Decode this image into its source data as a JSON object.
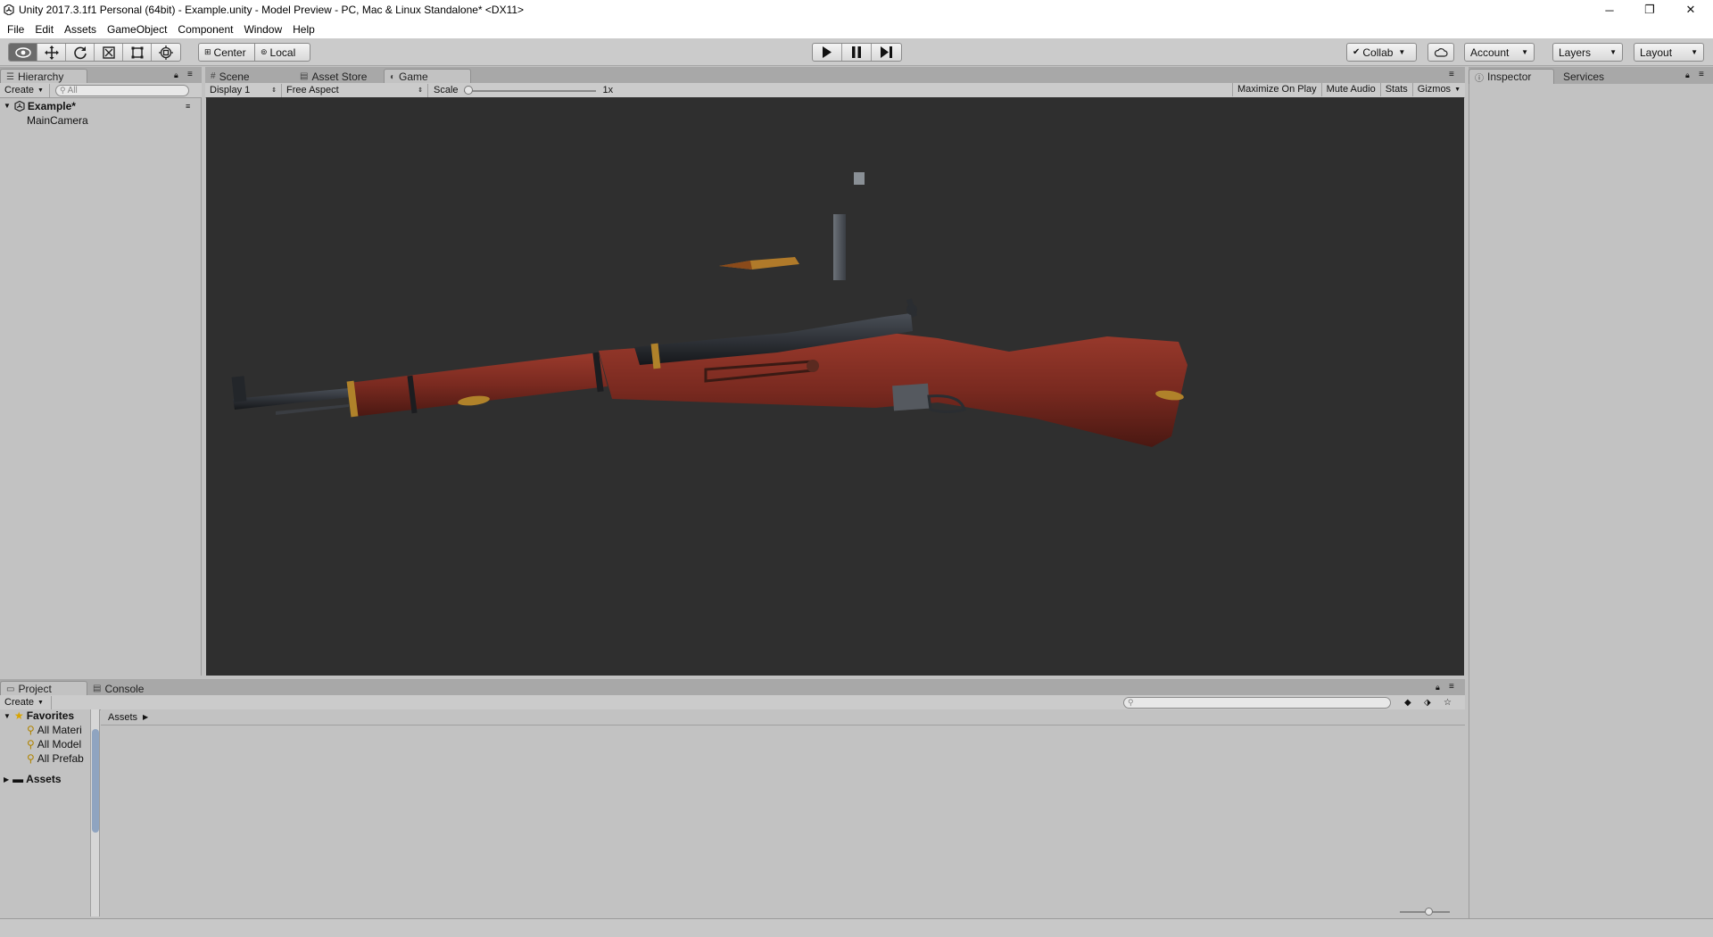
{
  "window": {
    "title": "Unity 2017.3.1f1 Personal (64bit) - Example.unity - Model Preview - PC, Mac & Linux Standalone* <DX11>",
    "minimize_glyph": "─",
    "restore_glyph": "❐",
    "close_glyph": "✕"
  },
  "menu": [
    "File",
    "Edit",
    "Assets",
    "GameObject",
    "Component",
    "Window",
    "Help"
  ],
  "toolbar": {
    "tools": [
      "view-tool",
      "move-tool",
      "rotate-tool",
      "scale-tool",
      "rect-tool",
      "transform-tool"
    ],
    "active_tool": "view-tool",
    "pivot_label": "Center",
    "space_label": "Local",
    "collab_label": "Collab",
    "account_label": "Account",
    "layers_label": "Layers",
    "layout_label": "Layout"
  },
  "hierarchy": {
    "tab_label": "Hierarchy",
    "create_label": "Create",
    "search_placeholder": "All",
    "scene_name": "Example*",
    "items": [
      "MainCamera"
    ]
  },
  "center_tabs": {
    "scene_label": "Scene",
    "asset_store_label": "Asset Store",
    "game_label": "Game",
    "active": "Game"
  },
  "game_view": {
    "display_label": "Display 1",
    "aspect_label": "Free Aspect",
    "scale_label": "Scale",
    "scale_value": "1x",
    "maximize_label": "Maximize On Play",
    "mute_label": "Mute Audio",
    "stats_label": "Stats",
    "gizmos_label": "Gizmos"
  },
  "right_tabs": {
    "inspector_label": "Inspector",
    "services_label": "Services"
  },
  "project": {
    "tab_label": "Project",
    "console_label": "Console",
    "create_label": "Create",
    "favorites_label": "Favorites",
    "favorites": [
      "All Materi",
      "All Model",
      "All Prefab"
    ],
    "assets_label": "Assets",
    "breadcrumb": "Assets"
  },
  "colors": {
    "editor_bg": "#c2c2c2",
    "game_bg": "#2f2f2f",
    "stock_wood": "#7a2a20",
    "metal": "#2a2d31",
    "brass": "#b0822a"
  }
}
